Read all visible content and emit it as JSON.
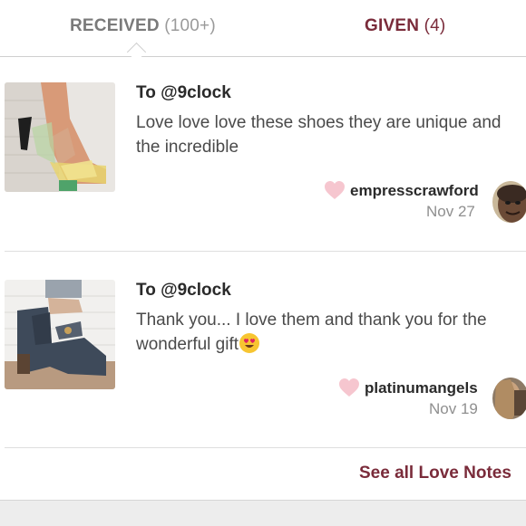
{
  "tabs": {
    "received": {
      "name": "RECEIVED",
      "count": "(100+)"
    },
    "given": {
      "name": "GIVEN",
      "count": "(4)"
    }
  },
  "notes": [
    {
      "to": "To @9clock",
      "message": "Love love love these shoes they are unique and the incredible",
      "user": "empresscrawford",
      "date": "Nov 27"
    },
    {
      "to": "To @9clock",
      "message": "Thank you... I love them and thank you for the wonderful gift",
      "user": "platinumangels",
      "date": "Nov 19"
    }
  ],
  "footer": {
    "see_all": "See all Love Notes"
  },
  "colors": {
    "accent": "#7a2b3a",
    "heart": "#f6c6cf"
  },
  "icons": [
    "heart-icon",
    "heart-eyes-emoji-icon"
  ]
}
